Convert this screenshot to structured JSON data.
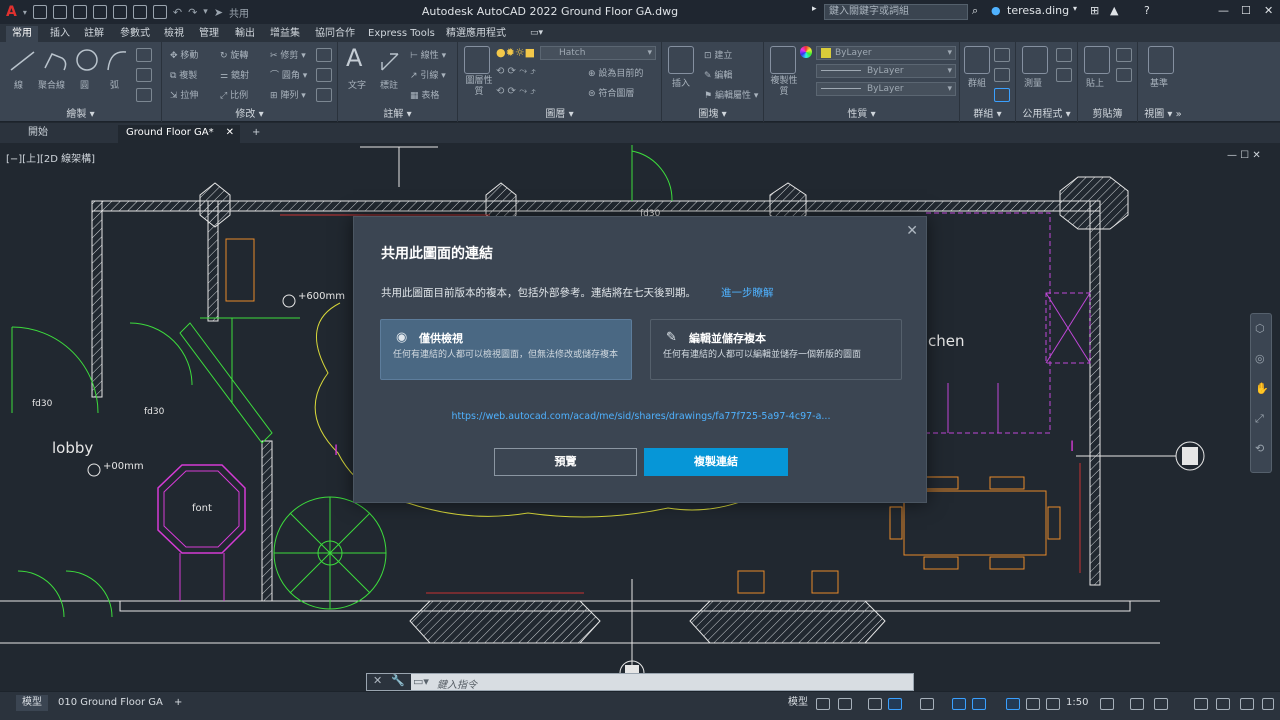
{
  "titlebar": {
    "app_title": "Autodesk AutoCAD 2022   Ground Floor  GA.dwg",
    "share_label": "共用",
    "search_placeholder": "鍵入關鍵字或詞組",
    "user_name": "teresa.ding"
  },
  "ribbon_tabs": [
    "常用",
    "插入",
    "註解",
    "參數式",
    "檢視",
    "管理",
    "輸出",
    "增益集",
    "協同合作",
    "Express Tools",
    "精選應用程式"
  ],
  "ribbon": {
    "panels": {
      "draw": "繪製",
      "modify": "修改",
      "annotation": "註解",
      "layers": "圖層",
      "block": "圖塊",
      "properties": "性質",
      "groups": "群組",
      "utilities": "公用程式",
      "clipboard": "剪貼簿",
      "view": "視圖"
    },
    "draw_items": {
      "line": "線",
      "polyline": "聚合線",
      "circle": "圓",
      "arc": "弧"
    },
    "modify_items": {
      "move": "移動",
      "rotate": "旋轉",
      "trim": "修剪",
      "copy": "複製",
      "mirror": "鏡射",
      "fillet": "圓角",
      "stretch": "拉伸",
      "scale": "比例",
      "array": "陣列"
    },
    "annotation_items": {
      "text": "文字",
      "dimension": "標註",
      "linear": "線性",
      "leader": "引線",
      "table": "表格"
    },
    "layer_items": {
      "layer_props": "圖層性質",
      "hatch": "Hatch",
      "set_current": "設為目前的",
      "match_layer": "符合圖層"
    },
    "block_items": {
      "insert": "插入",
      "create": "建立",
      "edit": "編輯",
      "edit_attr": "編輯屬性"
    },
    "property_items": {
      "match": "複製性質",
      "bylayer_color": "ByLayer",
      "bylayer_line": "ByLayer",
      "bylayer_weight": "ByLayer"
    },
    "group_item": "群組",
    "measure_item": "測量",
    "paste_item": "貼上",
    "base_item": "基準"
  },
  "doc_tabs": [
    "開始",
    "Ground Floor  GA*"
  ],
  "viewport_label": "[−][上][2D 線架構]",
  "drawing_labels": {
    "lobby": "lobby",
    "font": "font",
    "fd30_a": "fd30",
    "fd30_b": "fd30",
    "fd30_c": "fd30",
    "elev_a": "+600mm",
    "elev_b": "+00mm",
    "kitchen": "chen"
  },
  "modal": {
    "title": "共用此圖面的連結",
    "description": "共用此圖面目前版本的複本，包括外部參考。連結將在七天後到期。",
    "learn_more": "進一步瞭解",
    "option_view": {
      "title": "僅供檢視",
      "desc": "任何有連結的人都可以檢視圖面，但無法修改或儲存複本"
    },
    "option_edit": {
      "title": "編輯並儲存複本",
      "desc": "任何有連結的人都可以編輯並儲存一個新版的圖面"
    },
    "url": "https://web.autocad.com/acad/me/sid/shares/drawings/fa77f725-5a97-4c97-a...",
    "preview_button": "預覽",
    "copy_button": "複製連結"
  },
  "command_line": {
    "placeholder": "鍵入指令"
  },
  "statusbar": {
    "layout_tabs": [
      "模型",
      "010 Ground Floor GA"
    ],
    "model_label": "模型",
    "scale": "1:50"
  },
  "colors": {
    "accent": "#0696d7",
    "link": "#4fb2ff",
    "background": "#212830",
    "ribbon": "#3b4552"
  }
}
